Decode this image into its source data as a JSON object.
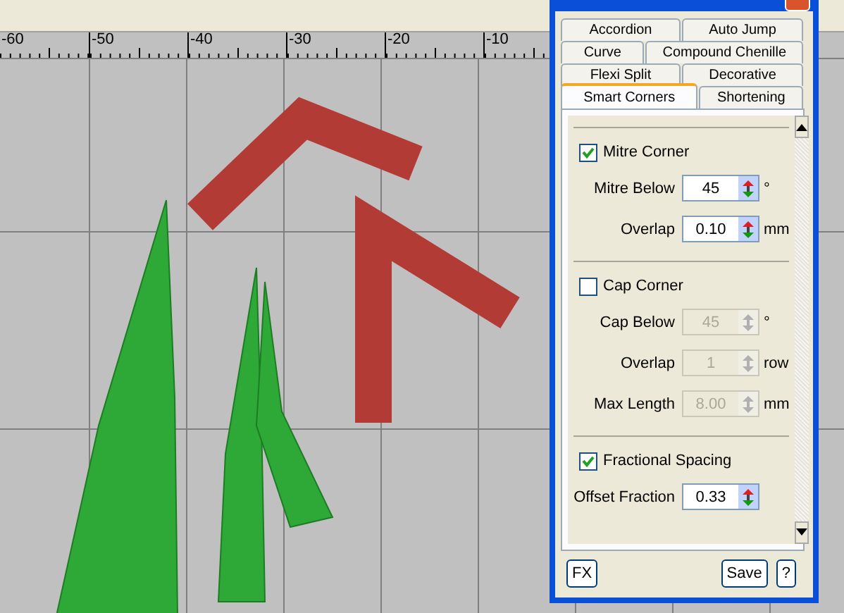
{
  "ruler": {
    "labels": [
      "-60",
      "-50",
      "-40",
      "-30",
      "-20",
      "-10"
    ]
  },
  "panel": {
    "tab_rows": [
      [
        {
          "label": "Accordion",
          "selected": false
        },
        {
          "label": "Auto Jump",
          "selected": false
        }
      ],
      [
        {
          "label": "Curve",
          "selected": false
        },
        {
          "label": "Compound Chenille",
          "selected": false
        }
      ],
      [
        {
          "label": "Flexi Split",
          "selected": false
        },
        {
          "label": "Decorative",
          "selected": false
        }
      ],
      [
        {
          "label": "Smart Corners",
          "selected": true
        },
        {
          "label": "Shortening",
          "selected": false
        }
      ]
    ],
    "rows": [
      {
        "kind": "divider"
      },
      {
        "kind": "checkbox",
        "label": "Mitre Corner",
        "checked": true
      },
      {
        "kind": "spin",
        "label": "Mitre Below",
        "value": "45",
        "unit": "°",
        "disabled": false
      },
      {
        "kind": "spin",
        "label": "Overlap",
        "value": "0.10",
        "unit": "mm",
        "disabled": false
      },
      {
        "kind": "divider"
      },
      {
        "kind": "checkbox",
        "label": "Cap Corner",
        "checked": false
      },
      {
        "kind": "spin",
        "label": "Cap Below",
        "value": "45",
        "unit": "°",
        "disabled": true
      },
      {
        "kind": "spin",
        "label": "Overlap",
        "value": "1",
        "unit": "row",
        "disabled": true
      },
      {
        "kind": "spin",
        "label": "Max Length",
        "value": "8.00",
        "unit": "mm",
        "disabled": true
      },
      {
        "kind": "divider"
      },
      {
        "kind": "checkbox",
        "label": "Fractional Spacing",
        "checked": true
      },
      {
        "kind": "spin",
        "label": "Offset Fraction",
        "value": "0.33",
        "unit": "",
        "disabled": false
      }
    ],
    "buttons": [
      "FX",
      "Save",
      "?"
    ]
  }
}
